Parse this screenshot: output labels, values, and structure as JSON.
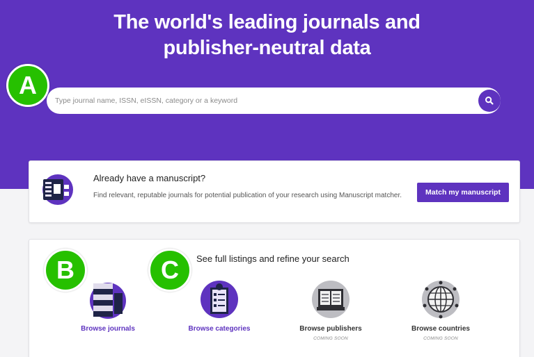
{
  "hero": {
    "title_line1": "The world's leading journals and",
    "title_line2": "publisher-neutral data",
    "background_color": "#5e33bf"
  },
  "search": {
    "placeholder": "Type journal name, ISSN, eISSN, category or a keyword",
    "button_icon": "search-icon"
  },
  "manuscript": {
    "icon": "manuscript-document-icon",
    "title": "Already have a manuscript?",
    "description": "Find relevant, reputable journals for potential publication of your research using Manuscript matcher.",
    "button_label": "Match my manuscript"
  },
  "browse": {
    "heading": "See full listings and refine your search",
    "items": [
      {
        "label": "Browse journals",
        "icon": "journals-stack-icon",
        "coming_soon": ""
      },
      {
        "label": "Browse categories",
        "icon": "categories-clipboard-icon",
        "coming_soon": ""
      },
      {
        "label": "Browse publishers",
        "icon": "publishers-book-icon",
        "coming_soon": "COMING SOON"
      },
      {
        "label": "Browse countries",
        "icon": "countries-globe-icon",
        "coming_soon": "COMING SOON"
      }
    ]
  },
  "annotations": {
    "a": "A",
    "b": "B",
    "c": "C",
    "color": "#26c000"
  }
}
